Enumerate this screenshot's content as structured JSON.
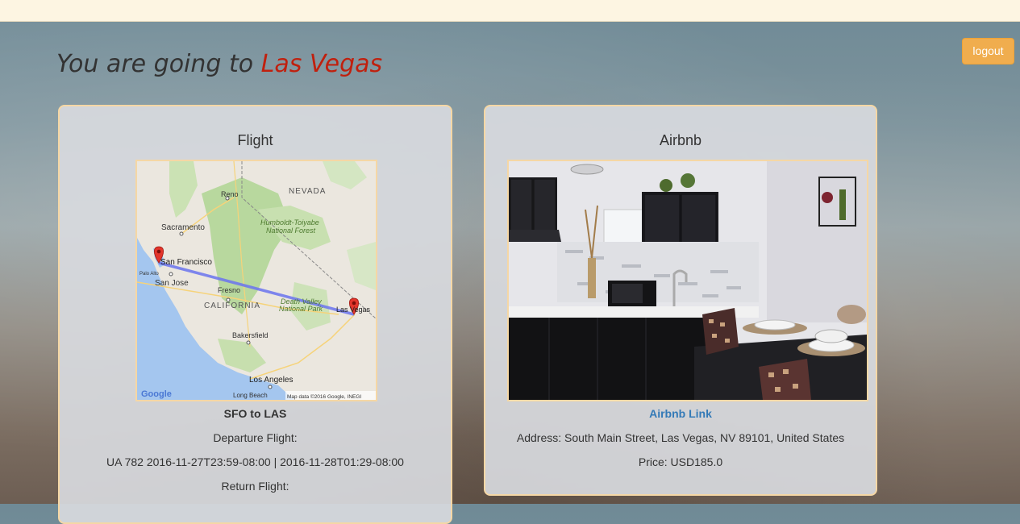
{
  "header": {
    "headline_prefix": "You are going to",
    "destination": "Las Vegas",
    "logout_label": "logout"
  },
  "flight": {
    "title": "Flight",
    "route": "SFO to LAS",
    "departure_label": "Departure Flight:",
    "departure_value": "UA 782 2016-11-27T23:59-08:00 | 2016-11-28T01:29-08:00",
    "return_label": "Return Flight:",
    "map": {
      "labels": {
        "nevada": "NEVADA",
        "reno": "Reno",
        "sacramento": "Sacramento",
        "forest_line1": "Humboldt-Toiyabe",
        "forest_line2": "National Forest",
        "san_francisco": "San Francisco",
        "palo_alto": "Palo Alto",
        "san_jose": "San Jose",
        "fresno": "Fresno",
        "california": "CALIFORNIA",
        "death_valley_line1": "Death Valley",
        "death_valley_line2": "National Park",
        "las_vegas": "Las Vegas",
        "bakersfield": "Bakersfield",
        "los_angeles": "Los Angeles",
        "long_beach": "Long Beach",
        "google": "Google",
        "attribution": "Map data ©2016 Google, INEGI"
      }
    }
  },
  "airbnb": {
    "title": "Airbnb",
    "link_label": "Airbnb Link",
    "address": "Address: South Main Street, Las Vegas, NV 89101, United States",
    "price": "Price: USD185.0"
  },
  "colors": {
    "accent_city": "#c0200e",
    "button": "#f0ad4e",
    "card_border": "#f5d7a5",
    "link": "#337ab7"
  }
}
